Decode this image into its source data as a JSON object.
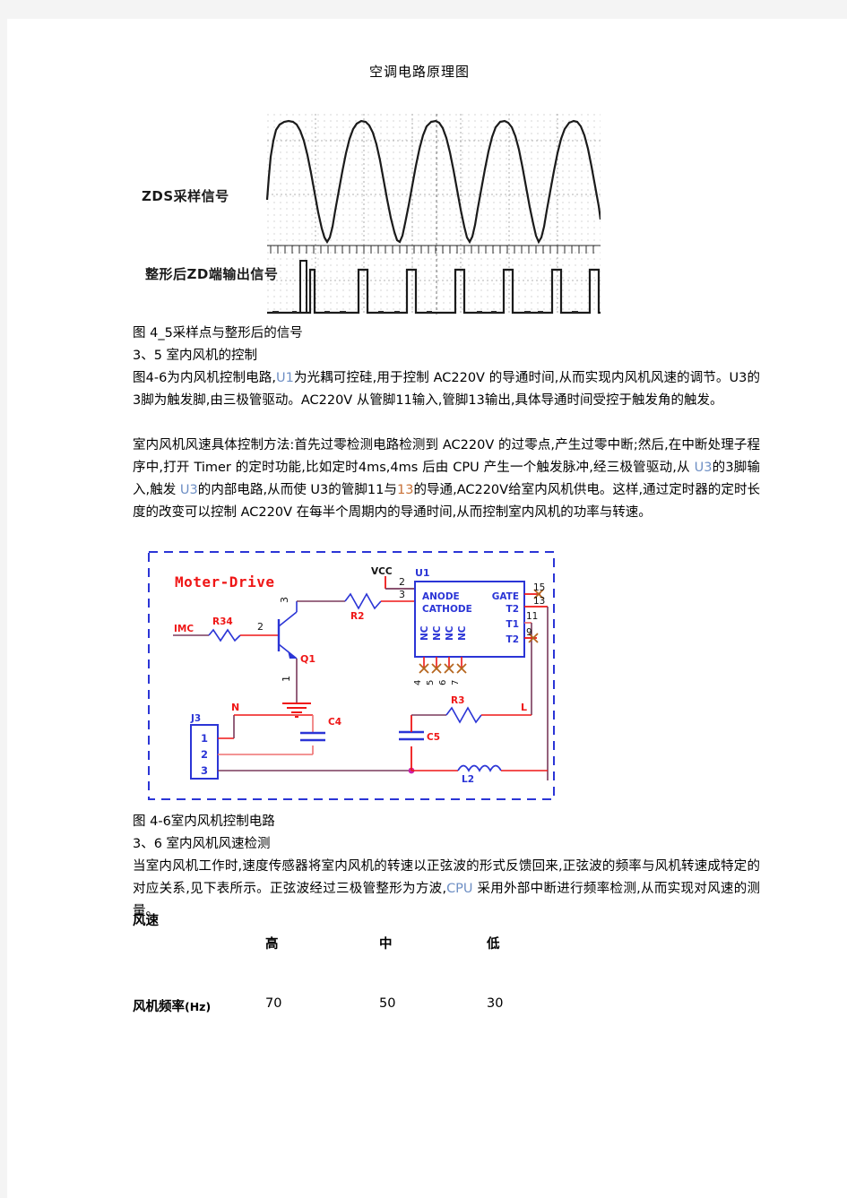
{
  "document": {
    "title": "空调电路原理图"
  },
  "figure_scope": {
    "caption": "图 4_5采样点与整形后的信号",
    "label_top": "ZDS采样信号",
    "label_bottom": "整形后ZD端输出信号"
  },
  "section_35": {
    "heading": "3、5 室内风机的控制",
    "para1_a": "图4-6为内风机控制电路,",
    "para1_u1": "U1",
    "para1_b": "为光耦可控硅,用于控制 AC220V 的导通时间,从而实现内风机风速的调节。U3的3脚为触发脚,由三极管驱动。AC220V 从管脚11输入,管脚13输出,具体导通时间受控于触发角的触发。",
    "para2_a": "室内风机风速具体控制方法:首先过零检测电路检测到 AC220V 的过零点,产生过零中断;然后,在中断处理子程序中,打开 Timer 的定时功能,比如定时4ms,4ms 后由 CPU 产生一个触发脉冲,经三极管驱动,从 ",
    "para2_u3a": "U3",
    "para2_b": "的3脚输入,触发 ",
    "para2_u3b": "U3",
    "para2_c": "的内部电路,从而使 U3的管脚11与",
    "para2_13": "13",
    "para2_d": "的导通,AC220V给室内风机供电。这样,通过定时器的定时长度的改变可以控制 AC220V 在每半个周期内的导通时间,从而控制室内风机的功率与转速。"
  },
  "figure_circuit": {
    "caption": "图 4-6室内风机控制电路",
    "title": "Moter-Drive",
    "labels": {
      "imc": "IMC",
      "r34": "R34",
      "q1": "Q1",
      "r2": "R2",
      "vcc": "VCC",
      "u1": "U1",
      "pin_base": "2",
      "pin_collector": "3",
      "pin_emitter": "1",
      "u1_pin2": "2",
      "u1_pin3": "3",
      "u1_anode": "ANODE",
      "u1_cathode": "CATHODE",
      "u1_gate": "GATE",
      "u1_t2a": "T2",
      "u1_t1": "T1",
      "u1_t2b": "T2",
      "u1_nc": "NC",
      "u1_pin15": "15",
      "u1_pin13": "13",
      "u1_pin11": "11",
      "u1_pin9": "9",
      "u1_nc4": "4",
      "u1_nc5": "5",
      "u1_nc6": "6",
      "u1_nc7": "7",
      "j3": "J3",
      "j3_p1": "1",
      "j3_p2": "2",
      "j3_p3": "3",
      "n": "N",
      "l": "L",
      "c4": "C4",
      "c5": "C5",
      "r3": "R3",
      "l2": "L2"
    }
  },
  "section_36": {
    "heading": "3、6 室内风机风速检测",
    "para_a": "当室内风机工作时,速度传感器将室内风机的转速以正弦波的形式反馈回来,正弦波的频率与风机转速成特定的对应关系,见下表所示。正弦波经过三极管整形为方波,",
    "para_cpu": "CPU",
    "para_b": " 采用外部中断进行频率检测,从而实现对风速的测量。"
  },
  "fan_table": {
    "row_header_label": "风速",
    "columns": [
      "高",
      "中",
      "低"
    ],
    "row_freq_label": "风机频率",
    "row_freq_unit": "(Hz)",
    "row_freq_values": [
      "70",
      "50",
      "30"
    ]
  }
}
